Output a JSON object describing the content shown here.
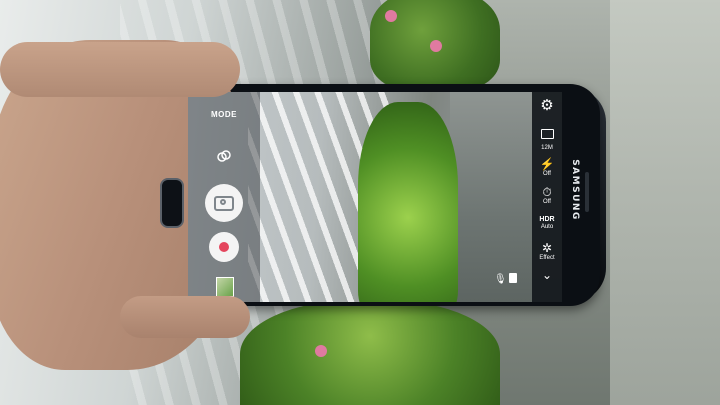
{
  "camera_app": {
    "mode_label": "MODE",
    "left_controls": {
      "effect_toggle_icon": "effect-toggle-icon",
      "shutter_icon": "camera-shutter-icon",
      "record_icon": "record-icon",
      "gallery_icon": "gallery-thumbnail"
    },
    "right_controls": [
      {
        "icon": "gear-icon",
        "label": ""
      },
      {
        "icon": "resolution-icon",
        "label": "12M"
      },
      {
        "icon": "flash-icon",
        "label": "Off"
      },
      {
        "icon": "timer-icon",
        "label": "Off"
      },
      {
        "title": "HDR",
        "label": "Auto"
      },
      {
        "icon": "effect-icon",
        "label": "Effect"
      },
      {
        "icon": "chevron-down-icon",
        "label": ""
      }
    ],
    "viewfinder_icons": [
      "microphone-icon",
      "document-icon"
    ]
  },
  "device": {
    "brand": "SAMSUNG"
  },
  "colors": {
    "record": "#e4455d",
    "panel": "#14181c"
  }
}
